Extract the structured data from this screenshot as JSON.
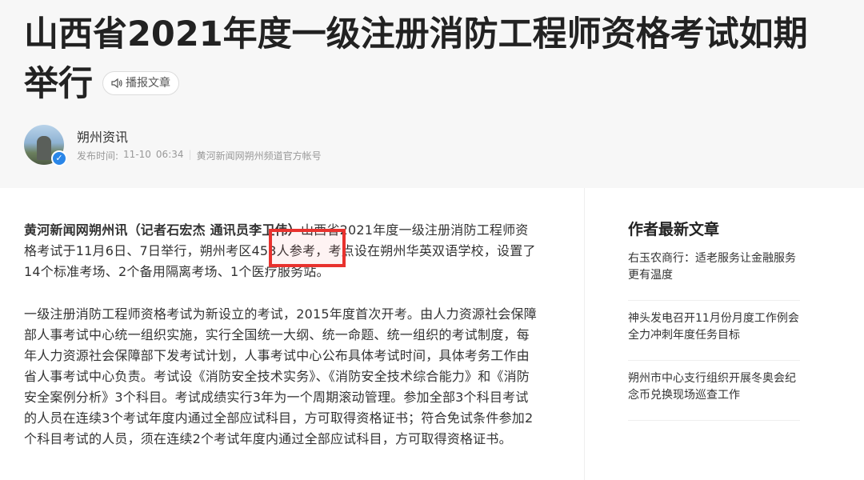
{
  "article": {
    "title_line1": "山西省2021年度一级注册消防工程师资格考试如期",
    "title_line2": "举行",
    "audio_label": "播报文章",
    "author": "朔州资讯",
    "publish_label": "发布时间:",
    "publish_date": "11-10",
    "publish_time": "06:34",
    "source": "黄河新闻网朔州频道官方帐号",
    "para1_lead": "黄河新闻网朔州讯（记者石宏杰 通讯员李卫伟）",
    "para1_text": "山西省2021年度一级注册消防工程师资格考试于11月6日、7日举行，朔州考区453人参考，考点设在朔州华英双语学校，设置了14个标准考场、2个备用隔离考场、1个医疗服务站。",
    "para2": "一级注册消防工程师资格考试为新设立的考试，2015年度首次开考。由人力资源社会保障部人事考试中心统一组织实施，实行全国统一大纲、统一命题、统一组织的考试制度，每年人力资源社会保障部下发考试计划，人事考试中心公布具体考试时间，具体考务工作由省人事考试中心负责。考试设《消防安全技术实务》、《消防安全技术综合能力》和《消防安全案例分析》3个科目。考试成绩实行3年为一个周期滚动管理。参加全部3个科目考试的人员在连续3个考试年度内通过全部应试科目，方可取得资格证书；符合免试条件参加2个科目考试的人员，须在连续2个考试年度内通过全部应试科目，方可取得资格证书。"
  },
  "sidebar": {
    "title": "作者最新文章",
    "articles": [
      "右玉农商行：适老服务让金融服务更有温度",
      "神头发电召开11月份月度工作例会 全力冲刺年度任务目标",
      "朔州市中心支行组织开展冬奥会纪念币兑换现场巡查工作"
    ]
  },
  "colors": {
    "header_bg": "#f7f7f7",
    "highlight": "#e8322e",
    "verified": "#2a86e8"
  }
}
